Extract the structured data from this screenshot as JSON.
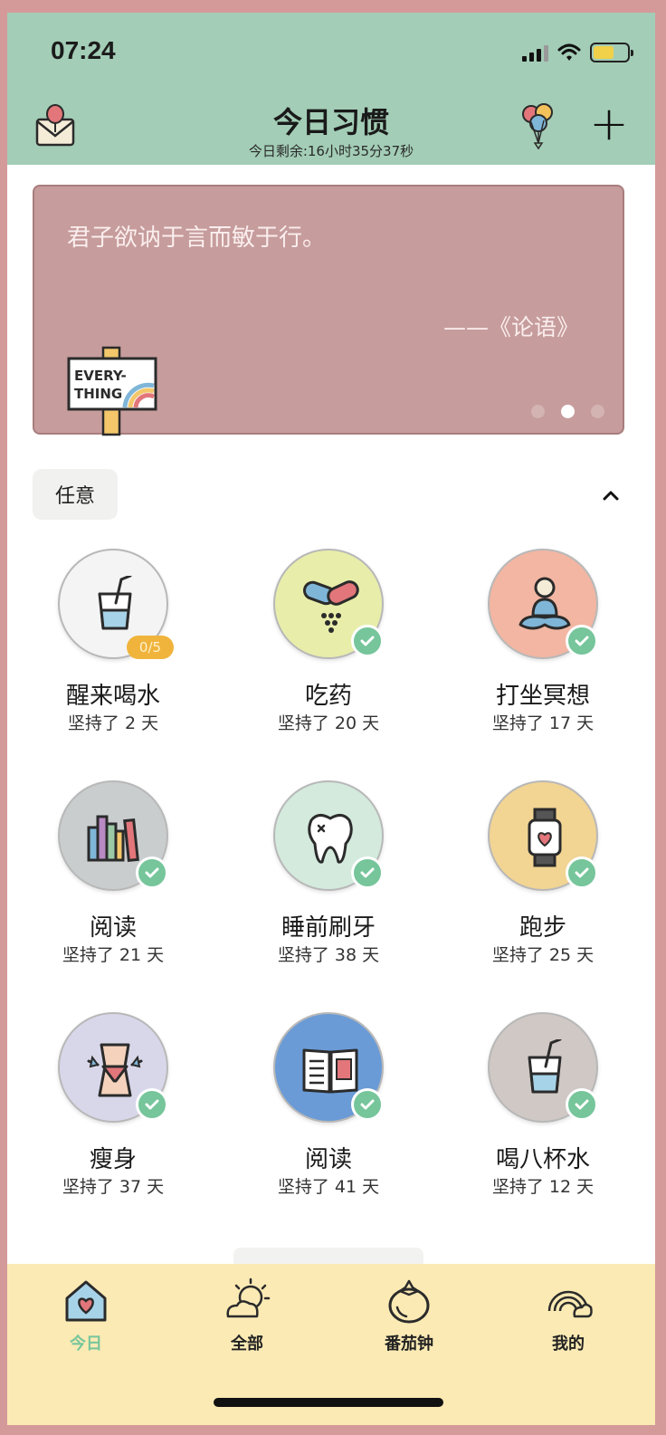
{
  "status": {
    "time": "07:24"
  },
  "header": {
    "title": "今日习惯",
    "subtitle": "今日剩余:16小时35分37秒",
    "add_label": "+"
  },
  "quote": {
    "text": "君子欲讷于言而敏于行。",
    "author": "——《论语》",
    "sign_line1": "EVERY-",
    "sign_line2": "THING",
    "active_page": 2,
    "page_count": 3
  },
  "section": {
    "label": "任意"
  },
  "habits": [
    {
      "name": "醒来喝水",
      "streak": "坚持了 2 天",
      "icon": "water-cup-icon",
      "color": "#f4f4f4",
      "done": false,
      "progress": "0/5"
    },
    {
      "name": "吃药",
      "streak": "坚持了 20 天",
      "icon": "pill-icon",
      "color": "#e8eeaa",
      "done": true
    },
    {
      "name": "打坐冥想",
      "streak": "坚持了 17 天",
      "icon": "meditation-icon",
      "color": "#f2b6a2",
      "done": true
    },
    {
      "name": "阅读",
      "streak": "坚持了 21 天",
      "icon": "books-icon",
      "color": "#c9cdce",
      "done": true
    },
    {
      "name": "睡前刷牙",
      "streak": "坚持了 38 天",
      "icon": "tooth-icon",
      "color": "#d3eadd",
      "done": true
    },
    {
      "name": "跑步",
      "streak": "坚持了 25 天",
      "icon": "watch-icon",
      "color": "#f2d493",
      "done": true
    },
    {
      "name": "瘦身",
      "streak": "坚持了 37 天",
      "icon": "waist-icon",
      "color": "#d8d7ea",
      "done": true
    },
    {
      "name": "阅读",
      "streak": "坚持了 41 天",
      "icon": "open-book-icon",
      "color": "#6a9bd6",
      "done": true
    },
    {
      "name": "喝八杯水",
      "streak": "坚持了 12 天",
      "icon": "water-cup-icon",
      "color": "#cfc8c4",
      "done": true
    }
  ],
  "tabs": [
    {
      "label": "今日",
      "icon": "home-heart-icon",
      "active": true
    },
    {
      "label": "全部",
      "icon": "sun-cloud-icon",
      "active": false
    },
    {
      "label": "番茄钟",
      "icon": "tomato-icon",
      "active": false
    },
    {
      "label": "我的",
      "icon": "rainbow-icon",
      "active": false
    }
  ],
  "colors": {
    "header_bg": "#a3cdb6",
    "quote_bg": "#c69c9c",
    "tabbar_bg": "#fbeab4",
    "accent_green": "#76c59b",
    "progress_orange": "#f0b43c"
  }
}
